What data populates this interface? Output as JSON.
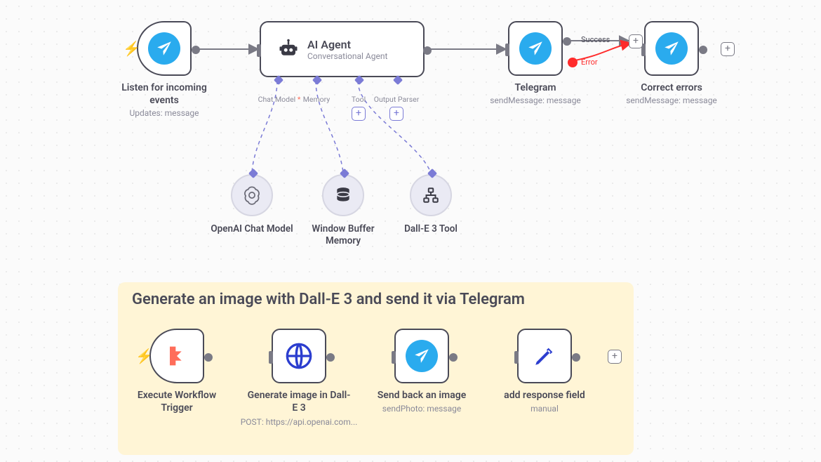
{
  "top_flow": {
    "nodes": {
      "trigger1": {
        "title": "Listen for incoming events",
        "sub": "Updates: message"
      },
      "agent": {
        "title": "AI Agent",
        "sub": "Conversational Agent",
        "ports": {
          "chat": "Chat Model",
          "memory": "Memory",
          "tool": "Tool",
          "parser": "Output Parser"
        }
      },
      "telegram2": {
        "title": "Telegram",
        "sub": "sendMessage: message"
      },
      "telegram3": {
        "title": "Correct errors",
        "sub": "sendMessage: message"
      },
      "status": {
        "success": "Success",
        "error": "Error"
      }
    },
    "subnodes": {
      "chat": {
        "title": "OpenAI Chat Model"
      },
      "memory": {
        "title": "Window Buffer Memory"
      },
      "tool": {
        "title": "Dall-E 3 Tool"
      }
    }
  },
  "group": {
    "title": "Generate an image with Dall-E 3 and send it via Telegram",
    "nodes": {
      "g_trigger": {
        "title": "Execute Workflow Trigger",
        "sub": ""
      },
      "g_http": {
        "title": "Generate image in Dall-E 3",
        "sub": "POST: https://api.openai.com..."
      },
      "g_send": {
        "title": "Send back an image",
        "sub": "sendPhoto: message"
      },
      "g_set": {
        "title": "add response field",
        "sub": "manual"
      }
    }
  }
}
